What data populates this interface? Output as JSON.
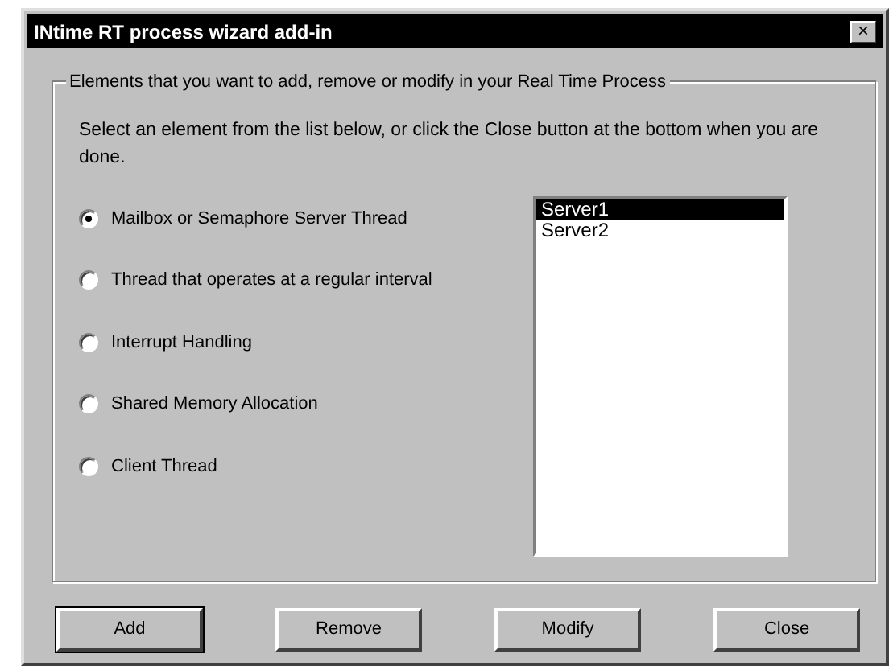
{
  "window": {
    "title": "INtime RT process wizard add-in",
    "close_glyph": "×"
  },
  "group": {
    "legend": "Elements that you want to add, remove or modify in your Real Time Process",
    "instructions": "Select an element from the list below, or click the Close button at the bottom when you are done."
  },
  "options": [
    {
      "label": "Mailbox or Semaphore Server Thread",
      "selected": true
    },
    {
      "label": "Thread that operates at a regular interval",
      "selected": false
    },
    {
      "label": "Interrupt Handling",
      "selected": false
    },
    {
      "label": "Shared Memory Allocation",
      "selected": false
    },
    {
      "label": "Client Thread",
      "selected": false
    }
  ],
  "list": [
    {
      "label": "Server1",
      "selected": true
    },
    {
      "label": "Server2",
      "selected": false
    }
  ],
  "buttons": [
    {
      "label": "Add",
      "default": true
    },
    {
      "label": "Remove",
      "default": false
    },
    {
      "label": "Modify",
      "default": false
    },
    {
      "label": "Close",
      "default": false
    }
  ]
}
